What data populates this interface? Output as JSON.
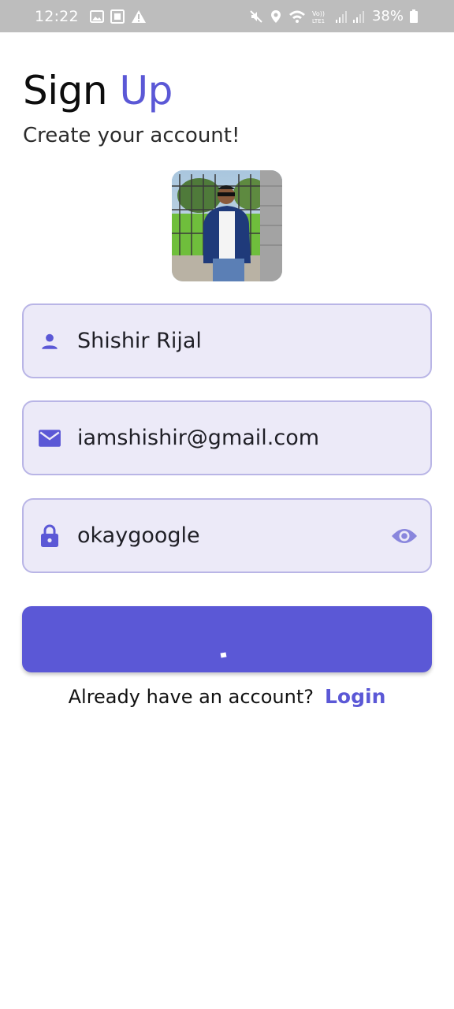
{
  "status_bar": {
    "time": "12:22",
    "battery": "38%",
    "icons_left": [
      "gallery-icon",
      "sim-icon",
      "warning-icon"
    ],
    "icons_right": [
      "mute-icon",
      "location-icon",
      "wifi-icon",
      "volte-icon",
      "signal-icon",
      "signal-icon",
      "battery-icon"
    ]
  },
  "header": {
    "title_primary": "Sign",
    "title_accent": "Up",
    "subtitle": "Create your account!"
  },
  "form": {
    "name": {
      "icon": "person-icon",
      "value": "Shishir Rijal"
    },
    "email": {
      "icon": "mail-icon",
      "value": "iamshishir@gmail.com"
    },
    "password": {
      "icon": "lock-icon",
      "value": "okaygoogle",
      "toggle_icon": "eye-icon"
    }
  },
  "submit": {
    "state": "loading"
  },
  "footer": {
    "prompt": "Already have an account?",
    "link": "Login"
  },
  "colors": {
    "accent": "#5b58d6",
    "field_bg": "#eceaf8",
    "field_border": "#b9b5e6",
    "status_bar_bg": "#bdbdbd"
  }
}
